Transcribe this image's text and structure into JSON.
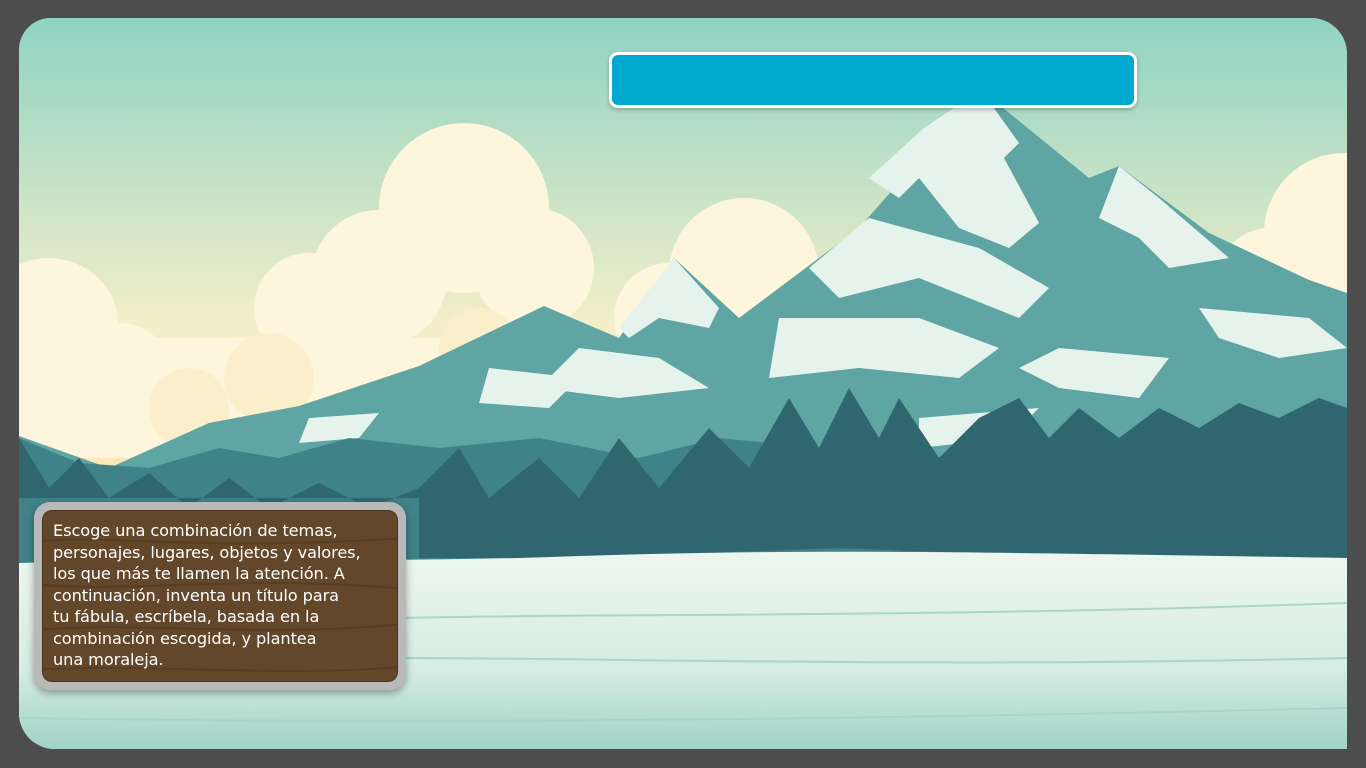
{
  "instruction": {
    "lines": [
      "Escoge una combinación de temas,",
      "personajes, lugares, objetos y valores,",
      "los que más te llamen la atención. A",
      "continuación, inventa un título para",
      "tu fábula, escríbela, basada en la",
      "combinación escogida, y plantea",
      "una moraleja."
    ]
  },
  "title_bar": {
    "text": ""
  },
  "colors": {
    "frame": "#4d4d4d",
    "title_bar": "#00aacf",
    "card_wood": "#62472a",
    "mountain": "#4f9a9a",
    "snow": "#e3f1ea",
    "forest": "#2f6670"
  }
}
